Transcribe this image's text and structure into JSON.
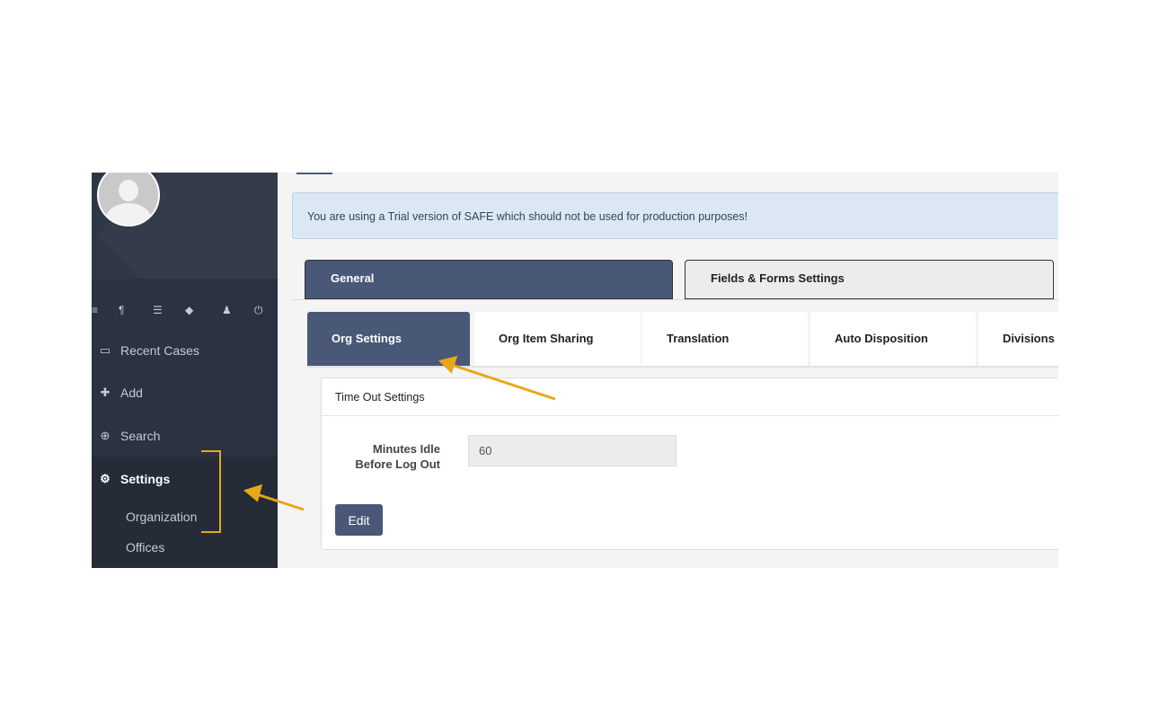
{
  "sidebar": {
    "toolbar_icons": [
      "grid-icon",
      "paragraph-icon",
      "list-icon",
      "tags-icon",
      "user-icon",
      "power-icon"
    ],
    "toolbar_glyphs": [
      "≡",
      "¶",
      "☰",
      "◆",
      "♟",
      "⏻"
    ],
    "nav": [
      {
        "label": "Recent Cases",
        "icon": "laptop-icon",
        "glyph": "▭"
      },
      {
        "label": "Add",
        "icon": "plus-icon",
        "glyph": "✚"
      },
      {
        "label": "Search",
        "icon": "search-icon",
        "glyph": "⊕"
      },
      {
        "label": "Settings",
        "icon": "gears-icon",
        "glyph": "⚙"
      }
    ],
    "sub_items": [
      "Organization",
      "Offices"
    ]
  },
  "alert": {
    "text": "You are using a Trial version of SAFE which should not be used for production purposes!"
  },
  "major_tabs": [
    {
      "label": "General",
      "active": true
    },
    {
      "label": "Fields & Forms Settings",
      "active": false
    }
  ],
  "sub_tabs": [
    {
      "label": "Org Settings",
      "active": true
    },
    {
      "label": "Org Item Sharing",
      "active": false
    },
    {
      "label": "Translation",
      "active": false
    },
    {
      "label": "Auto Disposition",
      "active": false
    },
    {
      "label": "Divisions",
      "active": false
    }
  ],
  "panel": {
    "title": "Time Out Settings",
    "field_label_line1": "Minutes Idle",
    "field_label_line2": "Before Log Out",
    "field_value": "60",
    "edit_label": "Edit"
  },
  "colors": {
    "accent": "#4a5878",
    "annotation": "#e6a817",
    "sidebar": "#2b3240"
  }
}
